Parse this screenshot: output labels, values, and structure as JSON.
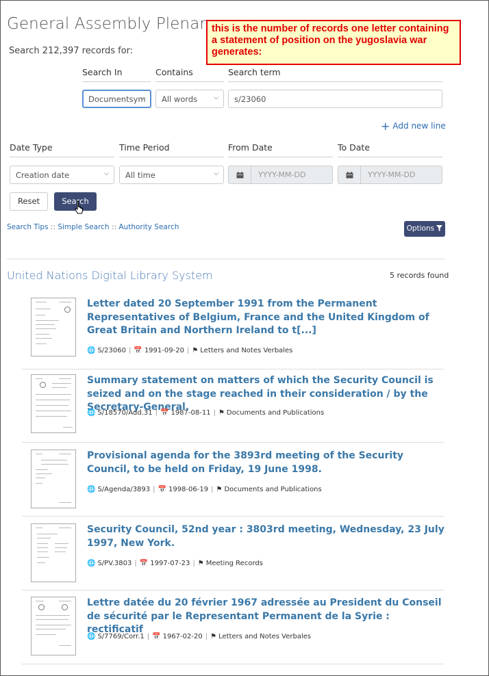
{
  "header": {
    "title": "General Assembly Plenary",
    "subtitle": "Search 212,397 records for:"
  },
  "annotation": {
    "text": "this is the number of records one letter containing a statement of position on the yugoslavia war generates:"
  },
  "search_row": {
    "labels": {
      "search_in": "Search In",
      "contains": "Contains",
      "search_term": "Search term"
    },
    "search_in_value": "Documentsym",
    "contains_value": "All words",
    "search_term_value": "s/23060",
    "add_new_line": "Add new line"
  },
  "date_row": {
    "labels": {
      "date_type": "Date Type",
      "time_period": "Time Period",
      "from_date": "From Date",
      "to_date": "To Date"
    },
    "date_type_value": "Creation date",
    "time_period_value": "All time",
    "from_placeholder": "YYYY-MM-DD",
    "to_placeholder": "YYYY-MM-DD"
  },
  "buttons": {
    "reset": "Reset",
    "search": "Search",
    "options": "Options"
  },
  "links": {
    "search_tips": "Search Tips",
    "simple_search": "Simple Search",
    "authority_search": "Authority Search",
    "separator": "::"
  },
  "results": {
    "section_title": "United Nations Digital Library System",
    "count": "5 records found",
    "records": [
      {
        "title": "Letter dated 20 September 1991 from the Permanent Representatives of Belgium, France and the United Kingdom of Great Britain and Northern Ireland to t[...]",
        "symbol": "S/23060",
        "date": "1991-09-20",
        "type": "Letters and Notes Verbales"
      },
      {
        "title": "Summary statement on matters of which the Security Council is seized and on the stage reached in their consideration / by the Secretary-General.",
        "symbol": "S/18570/Add.31",
        "date": "1987-08-11",
        "type": "Documents and Publications"
      },
      {
        "title": "Provisional agenda for the 3893rd meeting of the Security Council, to be held on Friday, 19 June 1998.",
        "symbol": "S/Agenda/3893",
        "date": "1998-06-19",
        "type": "Documents and Publications"
      },
      {
        "title": "Security Council, 52nd year : 3803rd meeting, Wednesday, 23 July 1997, New York.",
        "symbol": "S/PV.3803",
        "date": "1997-07-23",
        "type": "Meeting Records"
      },
      {
        "title": "Lettre datée du 20 février 1967 adressée au President du Conseil de sécurité par le Representant Permanent de la Syrie : rectificatif",
        "symbol": "S/7769/Corr.1",
        "date": "1967-02-20",
        "type": "Letters and Notes Verbales"
      }
    ]
  },
  "colors": {
    "link": "#2b6cb0",
    "record_title": "#3a78a8",
    "primary_button": "#3c4a74",
    "annotation_border": "#e00000",
    "annotation_bg": "#ffffc8"
  }
}
